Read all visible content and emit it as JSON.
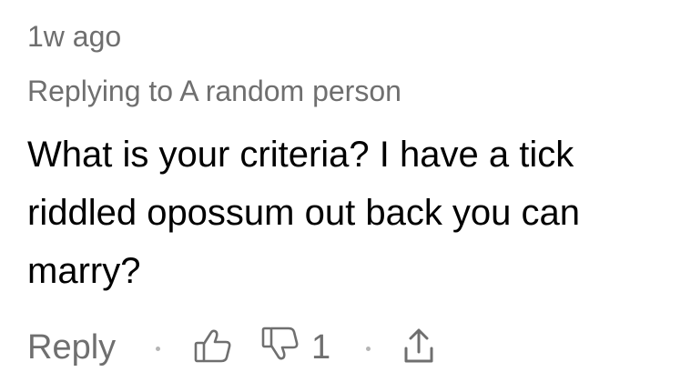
{
  "comment": {
    "timestamp": "1w ago",
    "replying_to": "Replying to A random person",
    "text": "What is your criteria? I have a tick riddled opossum out back you can marry?"
  },
  "actions": {
    "reply_label": "Reply",
    "dislike_count": "1",
    "like_icon": "thumbs-up-icon",
    "dislike_icon": "thumbs-down-icon",
    "share_icon": "share-icon"
  },
  "colors": {
    "meta_text": "#6f6f6f",
    "body_text": "#000000",
    "separator": "#b5b5b5"
  }
}
